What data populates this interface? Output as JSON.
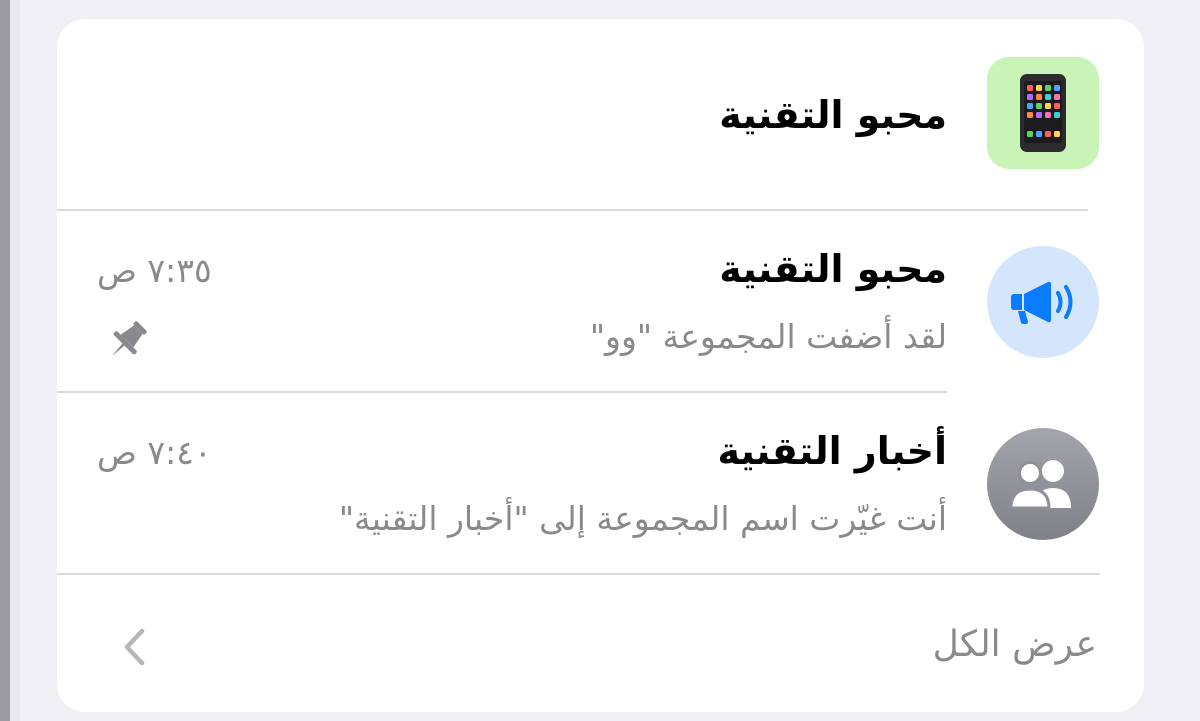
{
  "header_item": {
    "title": "محبو التقنية",
    "avatar_icon": "mobile-phone-icon",
    "avatar_bg": "#c9f3b7"
  },
  "chats": [
    {
      "title": "محبو التقنية",
      "preview": "لقد أضفت المجموعة \"وو\"",
      "time": "٧:٣٥ ص",
      "avatar_icon": "megaphone-icon",
      "avatar_bg": "#d5e6fc",
      "pinned": true,
      "pin_icon": "pin-icon"
    },
    {
      "title": "أخبار التقنية",
      "preview": "أنت غيّرت اسم المجموعة إلى \"أخبار التقنية\"",
      "time": "٧:٤٠ ص",
      "avatar_icon": "group-icon",
      "avatar_bg": "#8e8e95",
      "pinned": false
    }
  ],
  "footer": {
    "see_all_label": "عرض الكل",
    "chevron_icon": "chevron-left-icon"
  },
  "colors": {
    "background": "#efeff4",
    "card": "#ffffff",
    "secondary_text": "#8a8a8e",
    "accent_blue": "#0a7cff"
  }
}
